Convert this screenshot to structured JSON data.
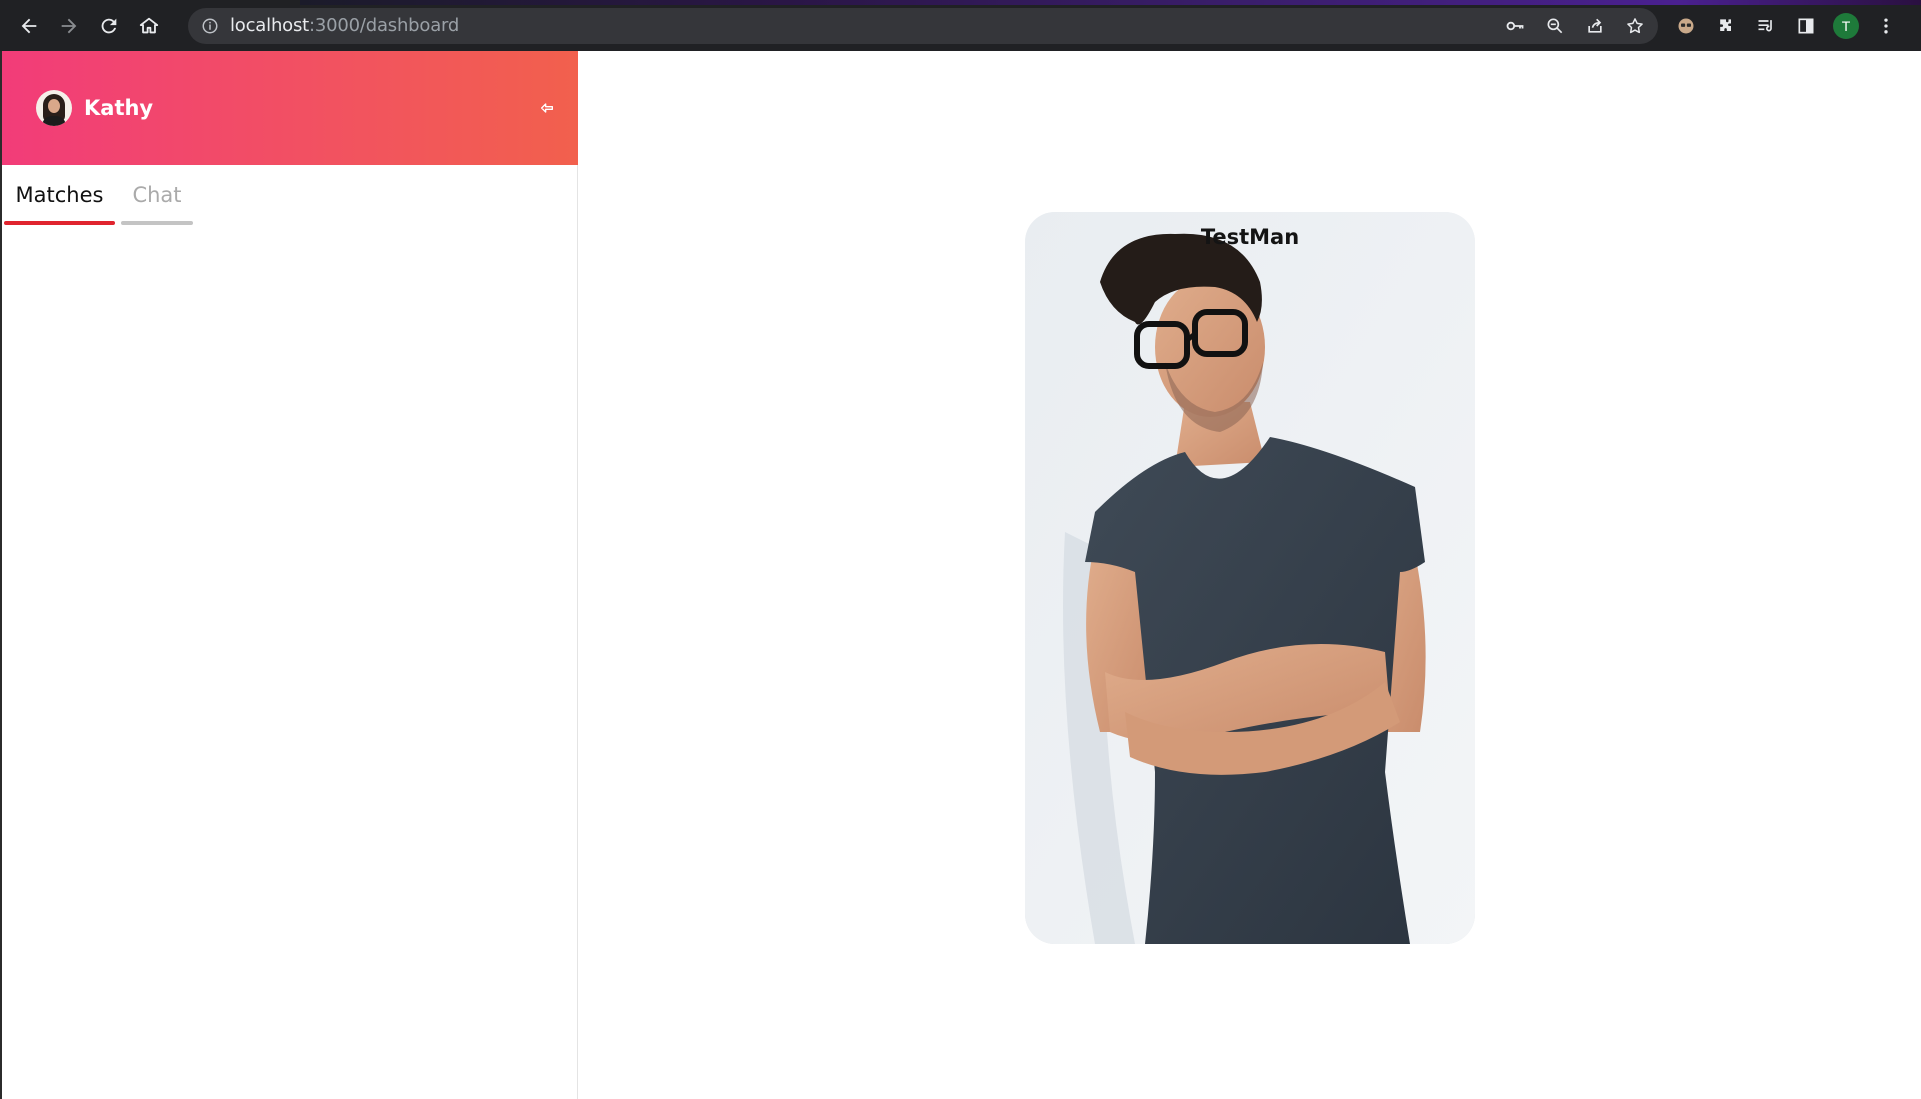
{
  "browser": {
    "url_host": "localhost",
    "url_path": ":3000/dashboard",
    "profile_initial": "T",
    "icons": {
      "back": "back-arrow-icon",
      "forward": "forward-arrow-icon",
      "reload": "reload-icon",
      "home": "home-icon",
      "info": "info-icon",
      "key": "key-icon",
      "zoom": "zoom-out-icon",
      "share": "share-icon",
      "bookmark": "star-icon",
      "extension_avatar": "extension-icon",
      "puzzle": "puzzle-icon",
      "media": "media-control-icon",
      "sidepanel": "side-panel-icon",
      "menu": "kebab-menu-icon"
    }
  },
  "sidebar": {
    "user_name": "Kathy",
    "header_colors": [
      "#f23c79",
      "#f2604d"
    ],
    "tabs": [
      {
        "label": "Matches",
        "active": true
      },
      {
        "label": "Chat",
        "active": false
      }
    ]
  },
  "card": {
    "name": "TestMan"
  }
}
